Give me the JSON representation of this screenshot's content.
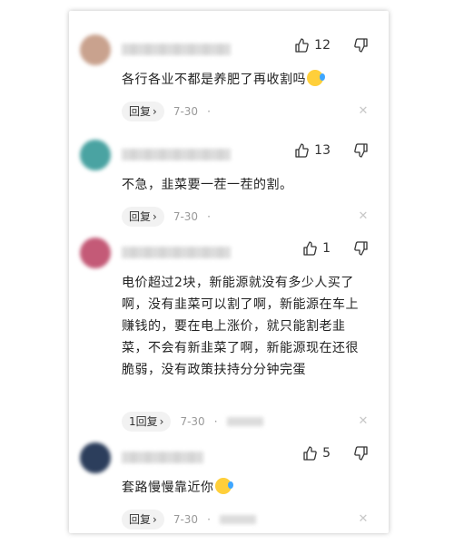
{
  "comments": [
    {
      "username": "",
      "likes": "12",
      "text": "各行各业不都是养肥了再收割吗",
      "reply_label": "回复",
      "reply_chevron": "›",
      "date": "7-30",
      "dot": "·",
      "avatar_color": "#c9a28e"
    },
    {
      "username": "",
      "likes": "13",
      "text": "不急，韭菜要一茬一茬的割。",
      "reply_label": "回复",
      "reply_chevron": "›",
      "date": "7-30",
      "dot": "·",
      "avatar_color": "#4aa3a2"
    },
    {
      "username": "",
      "likes": "1",
      "text": "电价超过2块，新能源就没有多少人买了啊，没有韭菜可以割了啊，新能源在车上赚钱的，要在电上涨价，就只能割老韭菜，不会有新韭菜了啊，新能源现在还很脆弱，没有政策扶持分分钟完蛋",
      "reply_label": "1回复",
      "reply_chevron": "›",
      "date": "7-30",
      "dot": "·",
      "avatar_color": "#c45a77"
    },
    {
      "username": "",
      "likes": "5",
      "text": "套路慢慢靠近你",
      "reply_label": "回复",
      "reply_chevron": "›",
      "date": "7-30",
      "dot": "·",
      "avatar_color": "#2c3e5c"
    }
  ],
  "icons": {
    "like": "thumbs-up-icon",
    "dislike": "thumbs-down-icon",
    "close": "close-icon",
    "emoji": "sweat-smile-emoji"
  },
  "close_glyph": "✕"
}
